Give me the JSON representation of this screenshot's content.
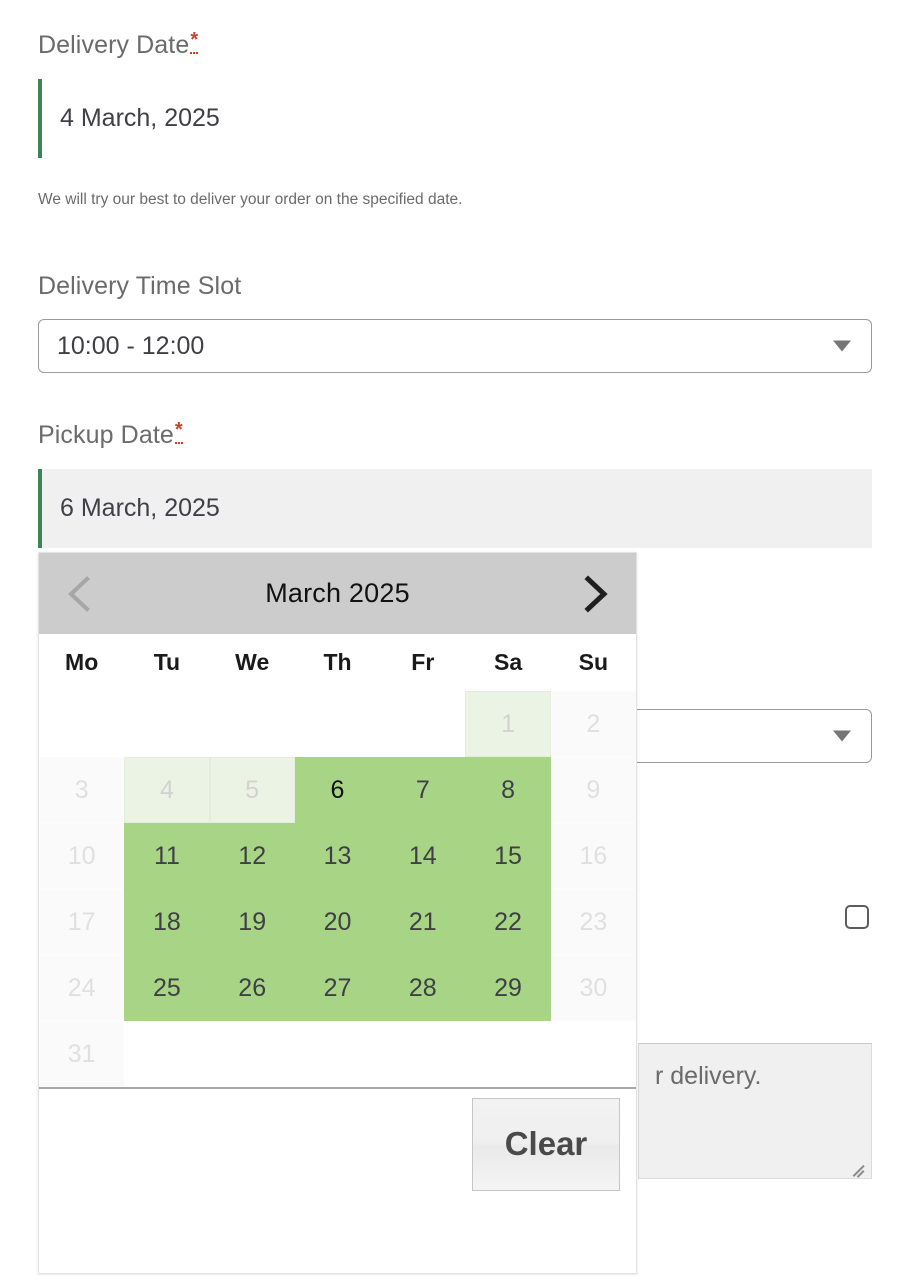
{
  "fields": {
    "delivery_date": {
      "label": "Delivery Date",
      "required_marker": "*",
      "value": "4 March, 2025",
      "helper": "We will try our best to deliver your order on the specified date."
    },
    "delivery_time_slot": {
      "label": "Delivery Time Slot",
      "value": "10:00 - 12:00"
    },
    "pickup_date": {
      "label": "Pickup Date",
      "required_marker": "*",
      "value": "6 March, 2025"
    },
    "notes": {
      "visible_text": "r delivery."
    }
  },
  "calendar": {
    "month_title": "March 2025",
    "prev_label": "Previous month",
    "next_label": "Next month",
    "weekdays": [
      "Mo",
      "Tu",
      "We",
      "Th",
      "Fr",
      "Sa",
      "Su"
    ],
    "clear_label": "Clear",
    "selected_day": 6,
    "weeks": [
      [
        {
          "label": "",
          "state": "empty"
        },
        {
          "label": "",
          "state": "empty"
        },
        {
          "label": "",
          "state": "empty"
        },
        {
          "label": "",
          "state": "empty"
        },
        {
          "label": "",
          "state": "empty"
        },
        {
          "label": "1",
          "state": "range-disabled"
        },
        {
          "label": "2",
          "state": "off"
        }
      ],
      [
        {
          "label": "3",
          "state": "off"
        },
        {
          "label": "4",
          "state": "range-disabled"
        },
        {
          "label": "5",
          "state": "range-disabled"
        },
        {
          "label": "6",
          "state": "avail selected"
        },
        {
          "label": "7",
          "state": "avail"
        },
        {
          "label": "8",
          "state": "avail"
        },
        {
          "label": "9",
          "state": "off"
        }
      ],
      [
        {
          "label": "10",
          "state": "off"
        },
        {
          "label": "11",
          "state": "avail"
        },
        {
          "label": "12",
          "state": "avail"
        },
        {
          "label": "13",
          "state": "avail"
        },
        {
          "label": "14",
          "state": "avail"
        },
        {
          "label": "15",
          "state": "avail"
        },
        {
          "label": "16",
          "state": "off"
        }
      ],
      [
        {
          "label": "17",
          "state": "off"
        },
        {
          "label": "18",
          "state": "avail"
        },
        {
          "label": "19",
          "state": "avail"
        },
        {
          "label": "20",
          "state": "avail"
        },
        {
          "label": "21",
          "state": "avail"
        },
        {
          "label": "22",
          "state": "avail"
        },
        {
          "label": "23",
          "state": "off"
        }
      ],
      [
        {
          "label": "24",
          "state": "off"
        },
        {
          "label": "25",
          "state": "avail"
        },
        {
          "label": "26",
          "state": "avail"
        },
        {
          "label": "27",
          "state": "avail"
        },
        {
          "label": "28",
          "state": "avail"
        },
        {
          "label": "29",
          "state": "avail"
        },
        {
          "label": "30",
          "state": "off"
        }
      ],
      [
        {
          "label": "31",
          "state": "off"
        },
        {
          "label": "",
          "state": "empty"
        },
        {
          "label": "",
          "state": "empty"
        },
        {
          "label": "",
          "state": "empty"
        },
        {
          "label": "",
          "state": "empty"
        },
        {
          "label": "",
          "state": "empty"
        },
        {
          "label": "",
          "state": "empty"
        }
      ]
    ]
  },
  "colors": {
    "accent_green": "#3a8656",
    "available_day": "#a8d585",
    "in_range_disabled": "#ebf3e5",
    "header_gray": "#cccccc",
    "required_red": "#cc4125"
  }
}
